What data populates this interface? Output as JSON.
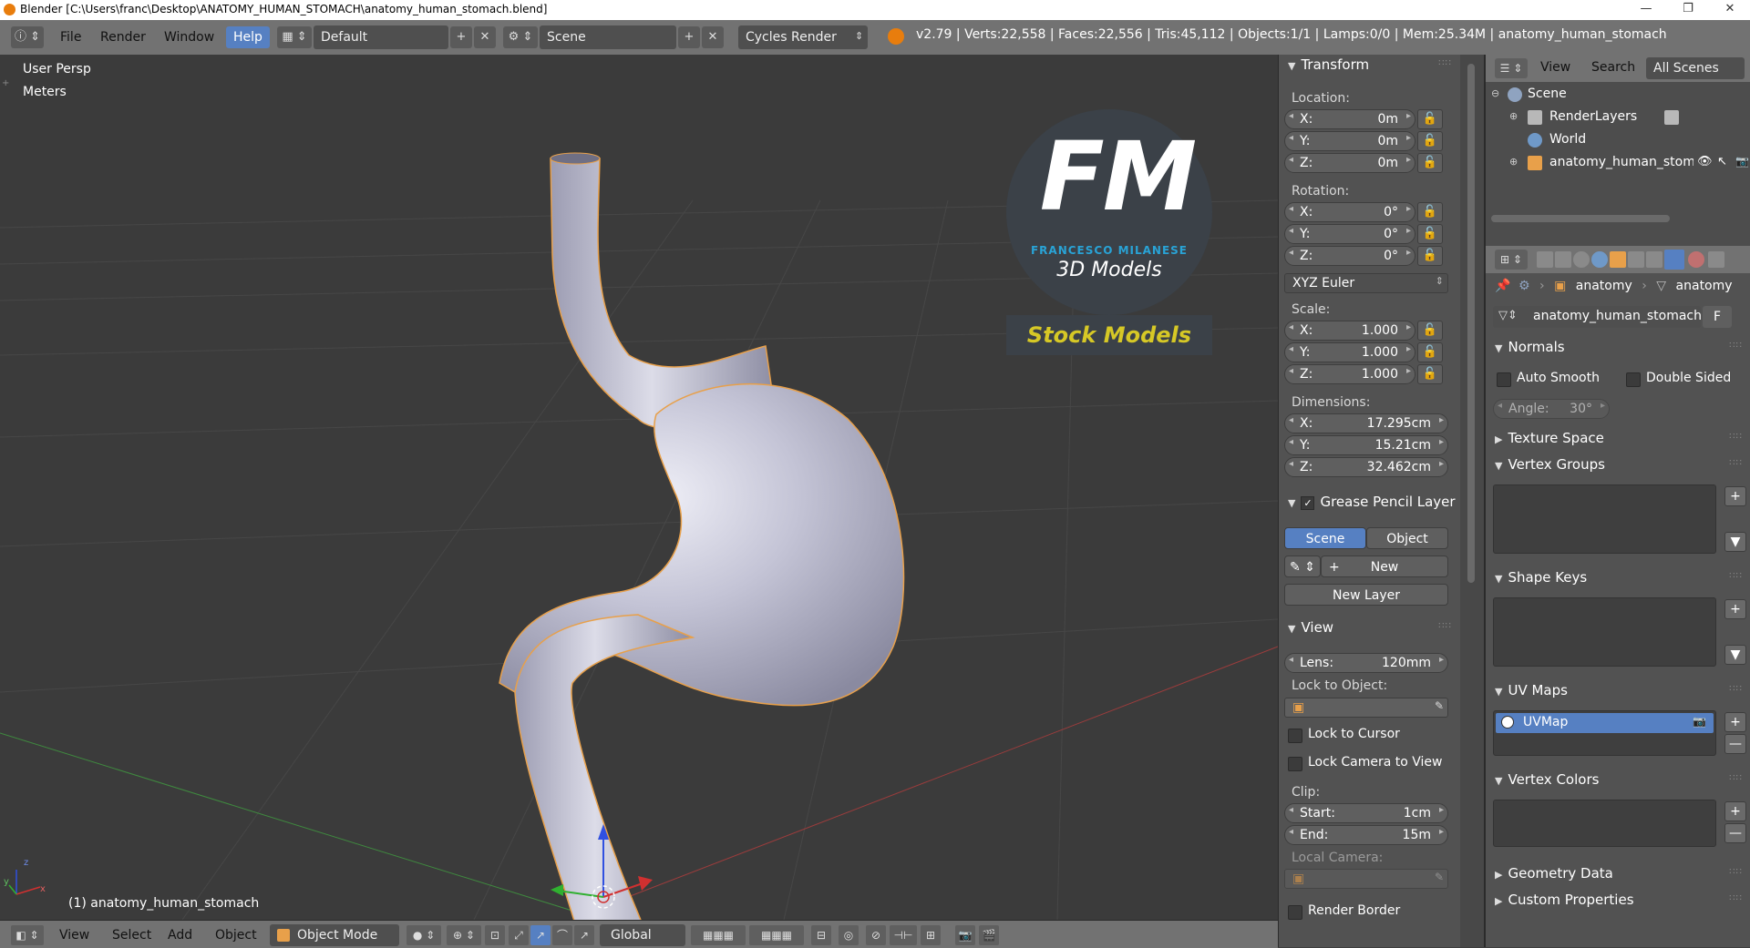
{
  "window": {
    "title": "Blender [C:\\Users\\franc\\Desktop\\ANATOMY_HUMAN_STOMACH\\anatomy_human_stomach.blend]",
    "controls": [
      "—",
      "❐",
      "✕"
    ]
  },
  "topbar": {
    "menus": [
      "File",
      "Render",
      "Window",
      "Help"
    ],
    "layout": "Default",
    "scene": "Scene",
    "engine": "Cycles Render",
    "stats": "v2.79 | Verts:22,558 | Faces:22,556 | Tris:45,112 | Objects:1/1 | Lamps:0/0 | Mem:25.34M | anatomy_human_stomach"
  },
  "viewport": {
    "view_name": "User Persp",
    "units": "Meters",
    "object_label": "(1) anatomy_human_stomach",
    "watermark": {
      "logo_text": "FM",
      "author": "FRANCESCO MILANESE",
      "subtitle": "3D Models",
      "banner": "Stock Models"
    },
    "axis_x": "x",
    "axis_y": "y",
    "axis_z": "z"
  },
  "bottombar": {
    "menus": [
      "View",
      "Select",
      "Add",
      "Object"
    ],
    "mode": "Object Mode",
    "orientation": "Global"
  },
  "npanel": {
    "transform_title": "Transform",
    "location_label": "Location:",
    "location": [
      {
        "axis": "X:",
        "value": "0m"
      },
      {
        "axis": "Y:",
        "value": "0m"
      },
      {
        "axis": "Z:",
        "value": "0m"
      }
    ],
    "rotation_label": "Rotation:",
    "rotation": [
      {
        "axis": "X:",
        "value": "0°"
      },
      {
        "axis": "Y:",
        "value": "0°"
      },
      {
        "axis": "Z:",
        "value": "0°"
      }
    ],
    "rotation_mode": "XYZ Euler",
    "scale_label": "Scale:",
    "scale": [
      {
        "axis": "X:",
        "value": "1.000"
      },
      {
        "axis": "Y:",
        "value": "1.000"
      },
      {
        "axis": "Z:",
        "value": "1.000"
      }
    ],
    "dimensions_label": "Dimensions:",
    "dimensions": [
      {
        "axis": "X:",
        "value": "17.295cm"
      },
      {
        "axis": "Y:",
        "value": "15.21cm"
      },
      {
        "axis": "Z:",
        "value": "32.462cm"
      }
    ],
    "grease_title": "Grease Pencil Layer",
    "grease_scene": "Scene",
    "grease_object": "Object",
    "grease_new": "New",
    "grease_new_layer": "New Layer",
    "view_title": "View",
    "lens_label": "Lens:",
    "lens_value": "120mm",
    "lock_object_label": "Lock to Object:",
    "lock_cursor": "Lock to Cursor",
    "lock_camera": "Lock Camera to View",
    "clip_label": "Clip:",
    "clip_start_label": "Start:",
    "clip_start": "1cm",
    "clip_end_label": "End:",
    "clip_end": "15m",
    "local_camera": "Local Camera:",
    "render_border": "Render Border"
  },
  "outliner": {
    "menus": [
      "View",
      "Search",
      "All Scenes"
    ],
    "items": [
      {
        "label": "Scene"
      },
      {
        "label": "RenderLayers"
      },
      {
        "label": "World"
      },
      {
        "label": "anatomy_human_stom"
      }
    ]
  },
  "properties": {
    "breadcrumb_object": "anatomy",
    "breadcrumb_mesh": "anatomy",
    "mesh_name": "anatomy_human_stomach",
    "fake_user": "F",
    "normals": "Normals",
    "auto_smooth": "Auto Smooth",
    "double_sided": "Double Sided",
    "angle_label": "Angle:",
    "angle_value": "30°",
    "texture_space": "Texture Space",
    "vertex_groups": "Vertex Groups",
    "shape_keys": "Shape Keys",
    "uv_maps": "UV Maps",
    "uv_map_item": "UVMap",
    "vertex_colors": "Vertex Colors",
    "geometry_data": "Geometry Data",
    "custom_properties": "Custom Properties"
  },
  "colors": {
    "selected_blue": "#5680c2",
    "outline_orange": "#e8a04a",
    "mesh_color": "#b9b9cc",
    "watermark_blue": "#29a3d6",
    "banner_yellow": "#d6c826"
  }
}
